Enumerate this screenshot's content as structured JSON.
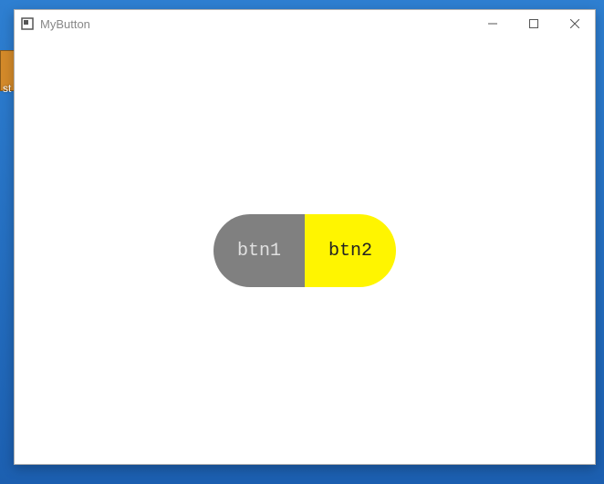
{
  "desktop": {
    "partial_label": "st"
  },
  "window": {
    "title": "MyButton",
    "controls": {
      "minimize": "—",
      "maximize": "☐",
      "close": "✕"
    }
  },
  "buttons": {
    "btn1": {
      "label": "btn1",
      "bg_color": "#808080",
      "text_color": "#e0e0e0"
    },
    "btn2": {
      "label": "btn2",
      "bg_color": "#fff500",
      "text_color": "#222222"
    }
  }
}
